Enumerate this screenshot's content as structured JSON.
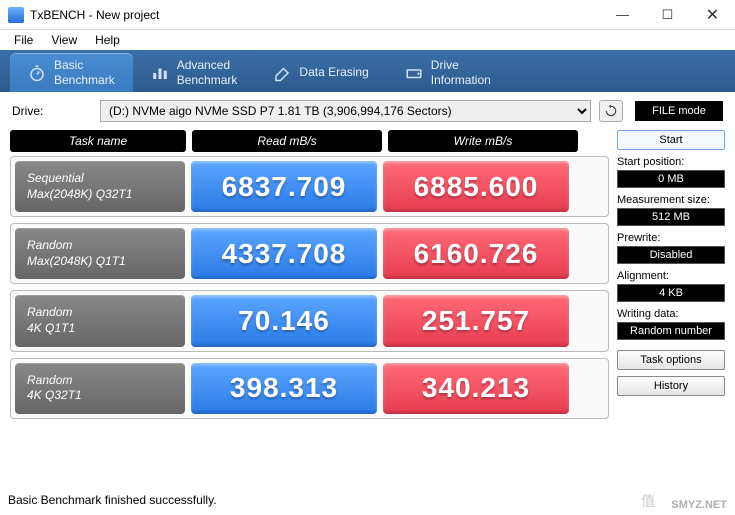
{
  "window": {
    "title": "TxBENCH - New project"
  },
  "menu": {
    "file": "File",
    "view": "View",
    "help": "Help"
  },
  "tabs": {
    "basic": "Basic\nBenchmark",
    "advanced": "Advanced\nBenchmark",
    "erase": "Data Erasing",
    "drive": "Drive\nInformation"
  },
  "drive": {
    "label": "Drive:",
    "selected": "(D:) NVMe aigo NVMe SSD P7  1.81 TB (3,906,994,176 Sectors)",
    "filemode": "FILE mode"
  },
  "headers": {
    "task": "Task name",
    "read": "Read mB/s",
    "write": "Write mB/s"
  },
  "rows": [
    {
      "name1": "Sequential",
      "name2": "Max(2048K) Q32T1",
      "read": "6837.709",
      "write": "6885.600"
    },
    {
      "name1": "Random",
      "name2": "Max(2048K) Q1T1",
      "read": "4337.708",
      "write": "6160.726"
    },
    {
      "name1": "Random",
      "name2": "4K Q1T1",
      "read": "70.146",
      "write": "251.757"
    },
    {
      "name1": "Random",
      "name2": "4K Q32T1",
      "read": "398.313",
      "write": "340.213"
    }
  ],
  "side": {
    "start": "Start",
    "startpos_lbl": "Start position:",
    "startpos": "0 MB",
    "msize_lbl": "Measurement size:",
    "msize": "512 MB",
    "prewrite_lbl": "Prewrite:",
    "prewrite": "Disabled",
    "align_lbl": "Alignment:",
    "align": "4 KB",
    "wdata_lbl": "Writing data:",
    "wdata": "Random number",
    "taskopt": "Task options",
    "history": "History"
  },
  "status": "Basic Benchmark finished successfully.",
  "watermark": "SMYZ.NET",
  "watermark2": "值"
}
